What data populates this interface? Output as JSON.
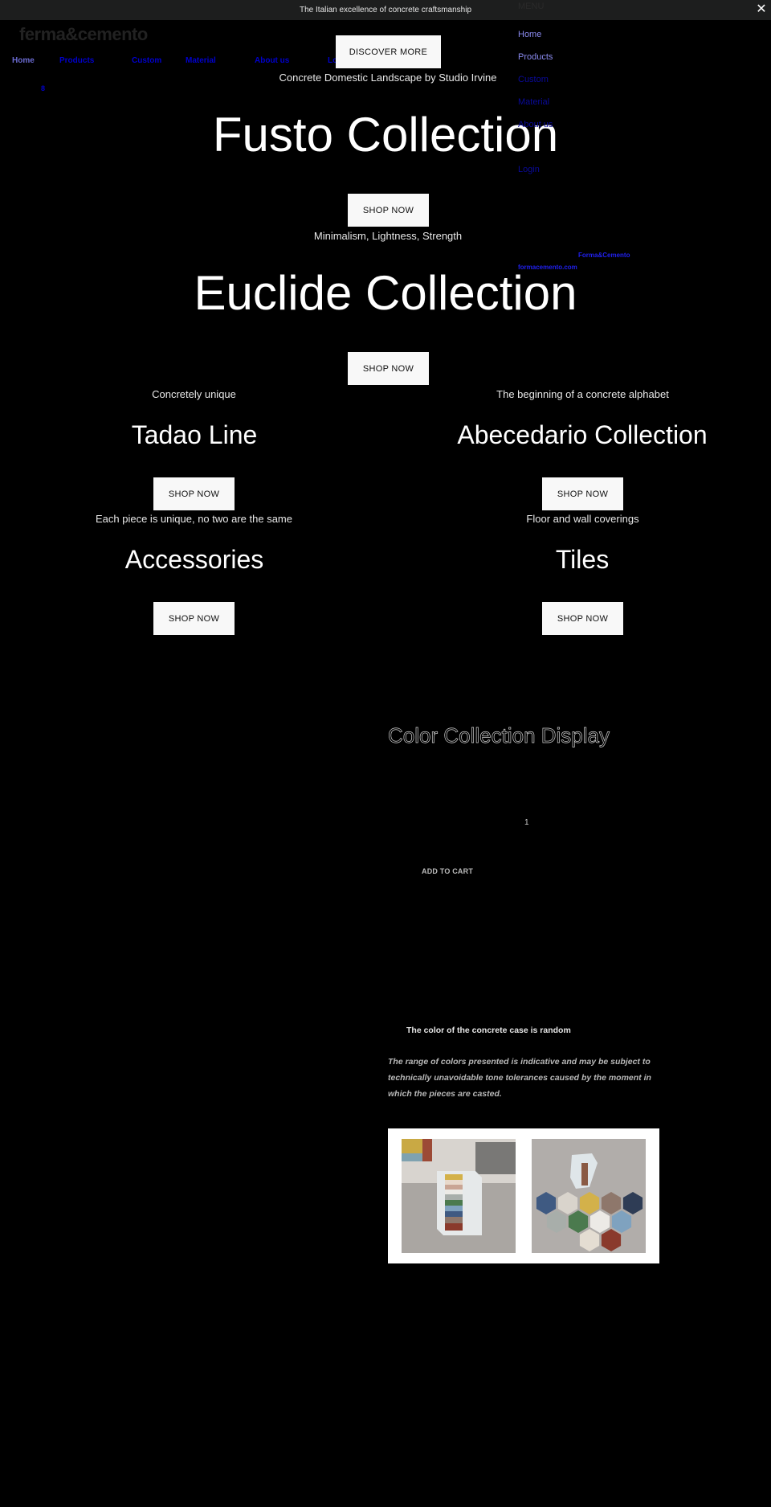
{
  "announcement": {
    "text": "The Italian excellence of concrete craftsmanship",
    "close_icon": "close-icon"
  },
  "brand": {
    "logo_text": "ferma&cemento"
  },
  "main_nav": {
    "items": [
      {
        "label": "Home"
      },
      {
        "label": "Products"
      },
      {
        "label": "Custom"
      },
      {
        "label": "Material"
      },
      {
        "label": "About us"
      },
      {
        "label": "Login"
      }
    ],
    "cart_count": "8"
  },
  "drawer": {
    "menu_label": "MENU",
    "items": [
      {
        "label": "Home"
      },
      {
        "label": "Products"
      },
      {
        "label": "Custom"
      },
      {
        "label": "Material"
      },
      {
        "label": "About us"
      },
      {
        "label": "Login"
      }
    ],
    "footer_brand": "Forma&Cemento",
    "footer_site": "formacemento.com"
  },
  "hero": {
    "discover_label": "DISCOVER MORE",
    "caption": "Concrete Domestic Landscape by Studio Irvine"
  },
  "collections": [
    {
      "title": "Fusto Collection",
      "button": "SHOP NOW",
      "caption": "Minimalism, Lightness, Strength"
    },
    {
      "title": "Euclide Collection",
      "button": "SHOP NOW"
    },
    {
      "caption": "Concretely unique",
      "title": "Tadao Line",
      "button": "SHOP NOW"
    },
    {
      "caption": "The beginning of a concrete alphabet",
      "title": "Abecedario Collection",
      "button": "SHOP NOW"
    },
    {
      "caption": "Each piece is unique, no two are the same",
      "title": "Accessories",
      "button": "SHOP NOW"
    },
    {
      "caption": "Floor and wall coverings",
      "title": "Tiles",
      "button": "SHOP NOW"
    }
  ],
  "product": {
    "title": "Color Collection Display",
    "quantity": "1",
    "add_to_cart": "ADD TO CART",
    "note_bold": "The color of the concrete case is random",
    "note_italic": "The range of colors presented is indicative and may be subject to technically unavoidable tone tolerances caused by the moment in which the pieces are casted.",
    "gallery": [
      {
        "alt": "Concrete hexagonal case holding stacked colored tiles"
      },
      {
        "alt": "Concrete case with hexagonal colored tiles arranged on a table"
      }
    ],
    "tile_colors": [
      "#3f5a82",
      "#d9d4cc",
      "#d3b14a",
      "#8e776b",
      "#2e3c55",
      "#a8aeaa",
      "#4b7a4e",
      "#eceae6",
      "#7fa2bf",
      "#e4ddd2",
      "#8a3a2c"
    ]
  }
}
